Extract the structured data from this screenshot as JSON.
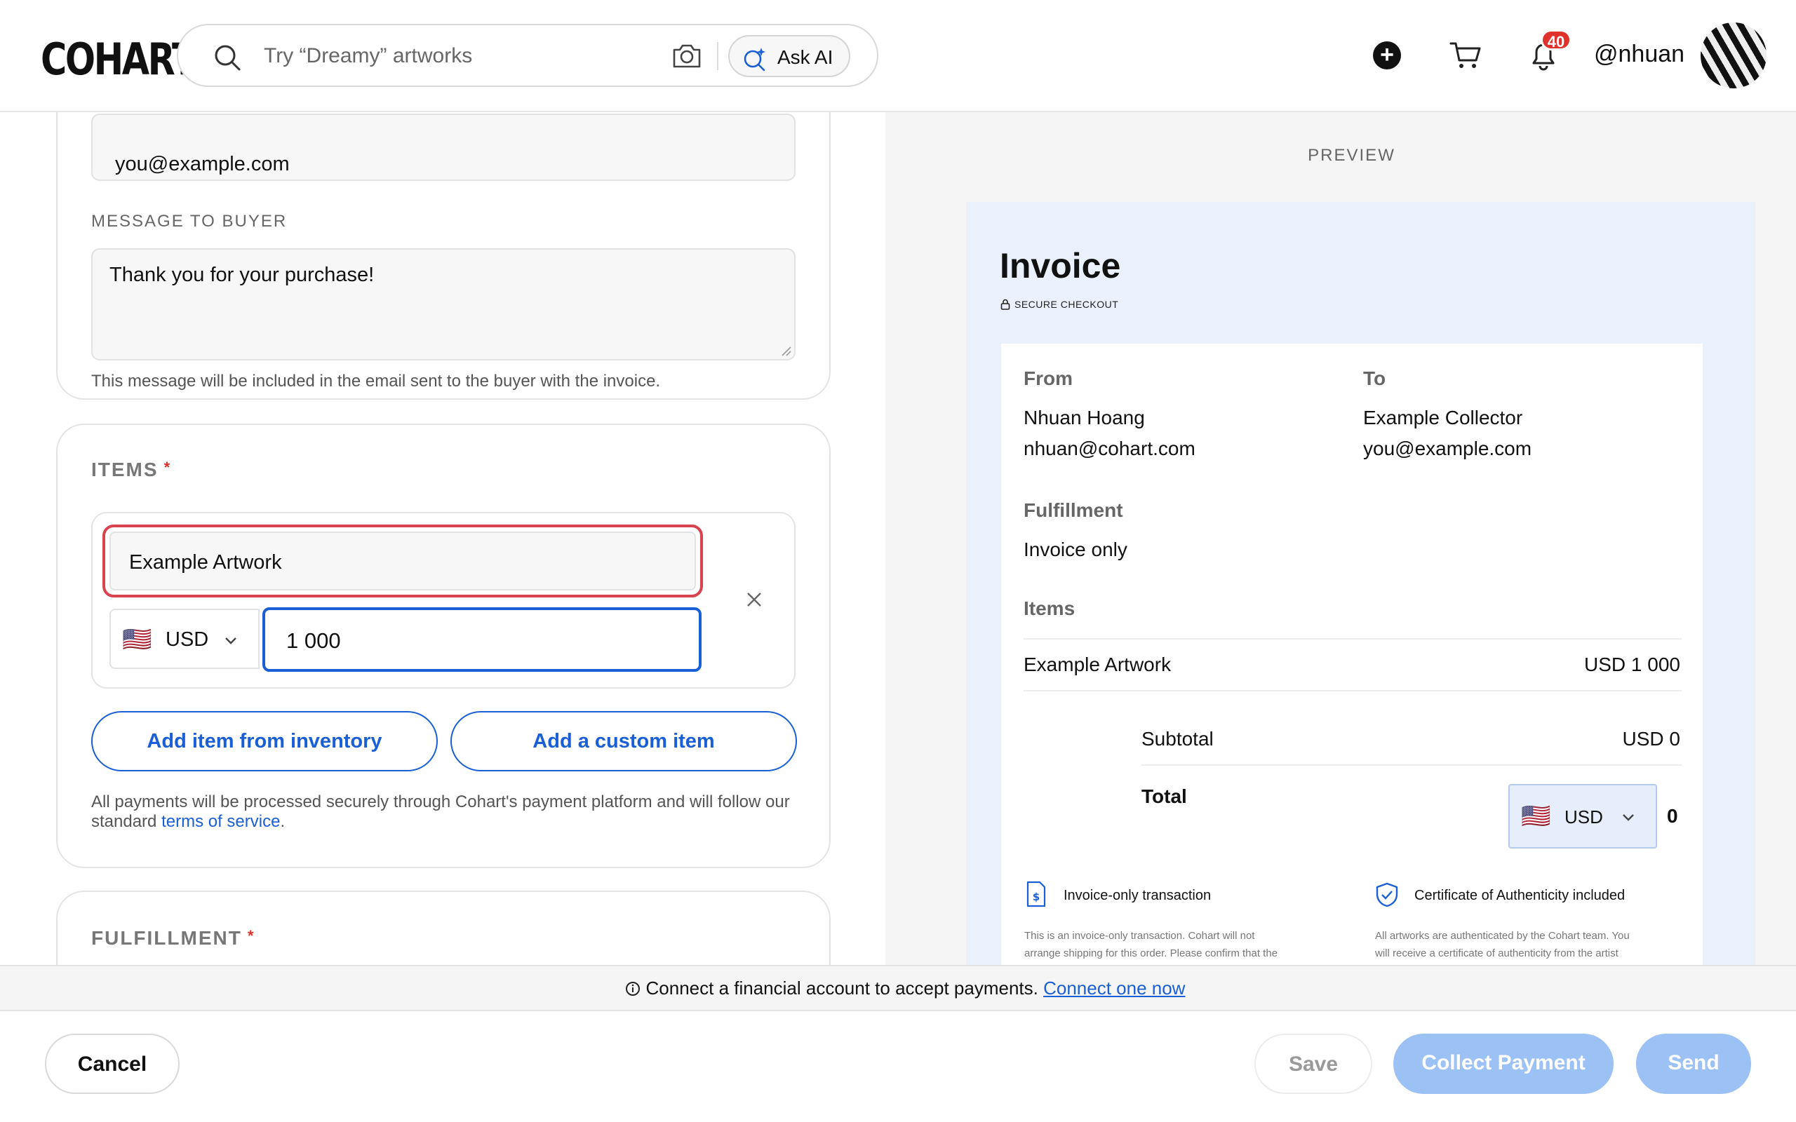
{
  "header": {
    "logo": "COHART",
    "search_placeholder": "Try “Dreamy” artworks",
    "ask_ai_label": "Ask AI",
    "notification_count": "40",
    "username": "@nhuan"
  },
  "form": {
    "email_value": "you@example.com",
    "message_label": "MESSAGE TO BUYER",
    "message_value": "Thank you for your purchase!",
    "message_helper": "This message will be included in the email sent to the buyer with the invoice.",
    "items_title": "ITEMS",
    "required_mark": "*",
    "item_name_value": "Example Artwork",
    "currency": "USD",
    "currency_flag": "🇺🇸",
    "price_value": "1 000",
    "add_inventory_label": "Add item from inventory",
    "add_custom_label": "Add a custom item",
    "payment_note": "All payments will be processed securely through Cohart's payment platform and will follow our standard",
    "terms_link": "terms of service",
    "terms_end": ".",
    "fulfillment_title": "FULFILLMENT"
  },
  "preview": {
    "label": "PREVIEW",
    "title": "Invoice",
    "secure_checkout": "SECURE CHECKOUT",
    "from_label": "From",
    "from_name": "Nhuan Hoang",
    "from_email": "nhuan@cohart.com",
    "to_label": "To",
    "to_name": "Example Collector",
    "to_email": "you@example.com",
    "fulfillment_label": "Fulfillment",
    "fulfillment_value": "Invoice only",
    "items_label": "Items",
    "item_name": "Example Artwork",
    "item_price": "USD 1 000",
    "subtotal_label": "Subtotal",
    "subtotal_value": "USD 0",
    "total_label": "Total",
    "total_currency": "USD",
    "total_value": "0",
    "invoice_only_title": "Invoice-only transaction",
    "invoice_only_text_1": "This is an invoice-only transaction. Cohart will not",
    "invoice_only_text_2": "arrange shipping for this order. Please confirm that the",
    "coa_title": "Certificate of Authenticity included",
    "coa_text_1": "All artworks are authenticated by the Cohart team. You",
    "coa_text_2": "will receive a certificate of authenticity from the artist"
  },
  "banner": {
    "text": "Connect a financial account to accept payments.",
    "link": "Connect one now"
  },
  "footer": {
    "cancel_label": "Cancel",
    "save_label": "Save",
    "collect_label": "Collect Payment",
    "send_label": "Send"
  },
  "colors": {
    "accent": "#1a5fd6",
    "error": "#d9434f",
    "disabled_button": "#9bc1f5"
  }
}
